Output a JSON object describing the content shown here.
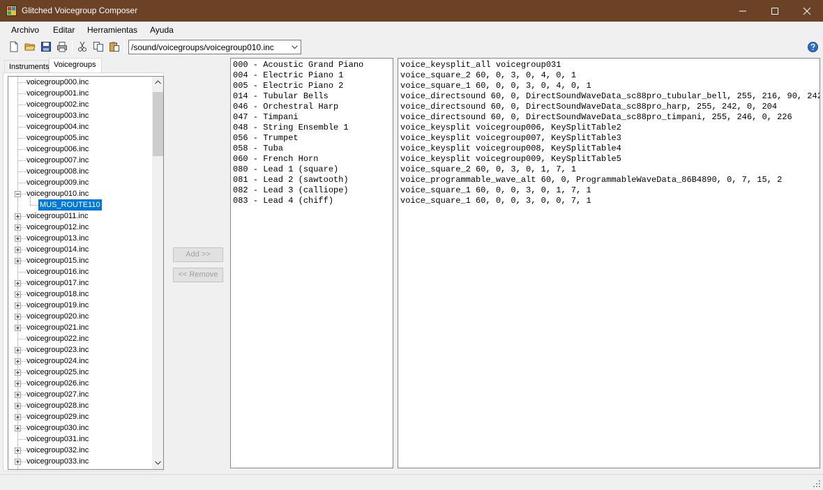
{
  "window": {
    "title": "Glitched Voicegroup Composer"
  },
  "menu": [
    "Archivo",
    "Editar",
    "Herramientas",
    "Ayuda"
  ],
  "toolbar": {
    "icons": [
      "new-file-icon",
      "open-folder-icon",
      "save-icon",
      "print-icon",
      "cut-icon",
      "copy-icon",
      "paste-icon",
      "help-icon"
    ],
    "path": "/sound/voicegroups/voicegroup010.inc"
  },
  "tabs": [
    "Instruments",
    "Voicegroups"
  ],
  "active_tab": "Voicegroups",
  "tree": {
    "items": [
      {
        "label": "voicegroup000.inc",
        "expandable": false
      },
      {
        "label": "voicegroup001.inc",
        "expandable": false
      },
      {
        "label": "voicegroup002.inc",
        "expandable": false
      },
      {
        "label": "voicegroup003.inc",
        "expandable": false
      },
      {
        "label": "voicegroup004.inc",
        "expandable": false
      },
      {
        "label": "voicegroup005.inc",
        "expandable": false
      },
      {
        "label": "voicegroup006.inc",
        "expandable": false
      },
      {
        "label": "voicegroup007.inc",
        "expandable": false
      },
      {
        "label": "voicegroup008.inc",
        "expandable": false
      },
      {
        "label": "voicegroup009.inc",
        "expandable": false
      },
      {
        "label": "voicegroup010.inc",
        "expandable": true,
        "expanded": true
      },
      {
        "label": "MUS_ROUTE110",
        "child": true,
        "selected": true
      },
      {
        "label": "voicegroup011.inc",
        "expandable": true
      },
      {
        "label": "voicegroup012.inc",
        "expandable": true
      },
      {
        "label": "voicegroup013.inc",
        "expandable": true
      },
      {
        "label": "voicegroup014.inc",
        "expandable": true
      },
      {
        "label": "voicegroup015.inc",
        "expandable": true
      },
      {
        "label": "voicegroup016.inc",
        "expandable": false
      },
      {
        "label": "voicegroup017.inc",
        "expandable": true
      },
      {
        "label": "voicegroup018.inc",
        "expandable": true
      },
      {
        "label": "voicegroup019.inc",
        "expandable": true
      },
      {
        "label": "voicegroup020.inc",
        "expandable": true
      },
      {
        "label": "voicegroup021.inc",
        "expandable": true
      },
      {
        "label": "voicegroup022.inc",
        "expandable": false
      },
      {
        "label": "voicegroup023.inc",
        "expandable": true
      },
      {
        "label": "voicegroup024.inc",
        "expandable": true
      },
      {
        "label": "voicegroup025.inc",
        "expandable": true
      },
      {
        "label": "voicegroup026.inc",
        "expandable": true
      },
      {
        "label": "voicegroup027.inc",
        "expandable": true
      },
      {
        "label": "voicegroup028.inc",
        "expandable": true
      },
      {
        "label": "voicegroup029.inc",
        "expandable": true
      },
      {
        "label": "voicegroup030.inc",
        "expandable": true
      },
      {
        "label": "voicegroup031.inc",
        "expandable": false
      },
      {
        "label": "voicegroup032.inc",
        "expandable": true
      },
      {
        "label": "voicegroup033.inc",
        "expandable": true
      }
    ]
  },
  "buttons": {
    "add": "Add >>",
    "remove": "<< Remove"
  },
  "instruments": [
    "000 - Acoustic Grand Piano",
    "004 - Electric Piano 1",
    "005 - Electric Piano 2",
    "014 - Tubular Bells",
    "046 - Orchestral Harp",
    "047 - Timpani",
    "048 - String Ensemble 1",
    "056 - Trumpet",
    "058 - Tuba",
    "060 - French Horn",
    "080 - Lead 1 (square)",
    "081 - Lead 2 (sawtooth)",
    "082 - Lead 3 (calliope)",
    "083 - Lead 4 (chiff)"
  ],
  "voice_lines": [
    "voice_keysplit_all voicegroup031",
    "voice_square_2 60, 0, 3, 0, 4, 0, 1",
    "voice_square_1 60, 0, 0, 3, 0, 4, 0, 1",
    "voice_directsound 60, 0, DirectSoundWaveData_sc88pro_tubular_bell, 255, 216, 90, 242",
    "voice_directsound 60, 0, DirectSoundWaveData_sc88pro_harp, 255, 242, 0, 204",
    "voice_directsound 60, 0, DirectSoundWaveData_sc88pro_timpani, 255, 246, 0, 226",
    "voice_keysplit voicegroup006, KeySplitTable2",
    "voice_keysplit voicegroup007, KeySplitTable3",
    "voice_keysplit voicegroup008, KeySplitTable4",
    "voice_keysplit voicegroup009, KeySplitTable5",
    "voice_square_2 60, 0, 3, 0, 1, 7, 1",
    "voice_programmable_wave_alt 60, 0, ProgrammableWaveData_86B4890, 0, 7, 15, 2",
    "voice_square_1 60, 0, 0, 3, 0, 1, 7, 1",
    "voice_square_1 60, 0, 0, 3, 0, 0, 7, 1"
  ],
  "colors": {
    "titlebar": "#6b4226",
    "selection": "#0078d7"
  }
}
